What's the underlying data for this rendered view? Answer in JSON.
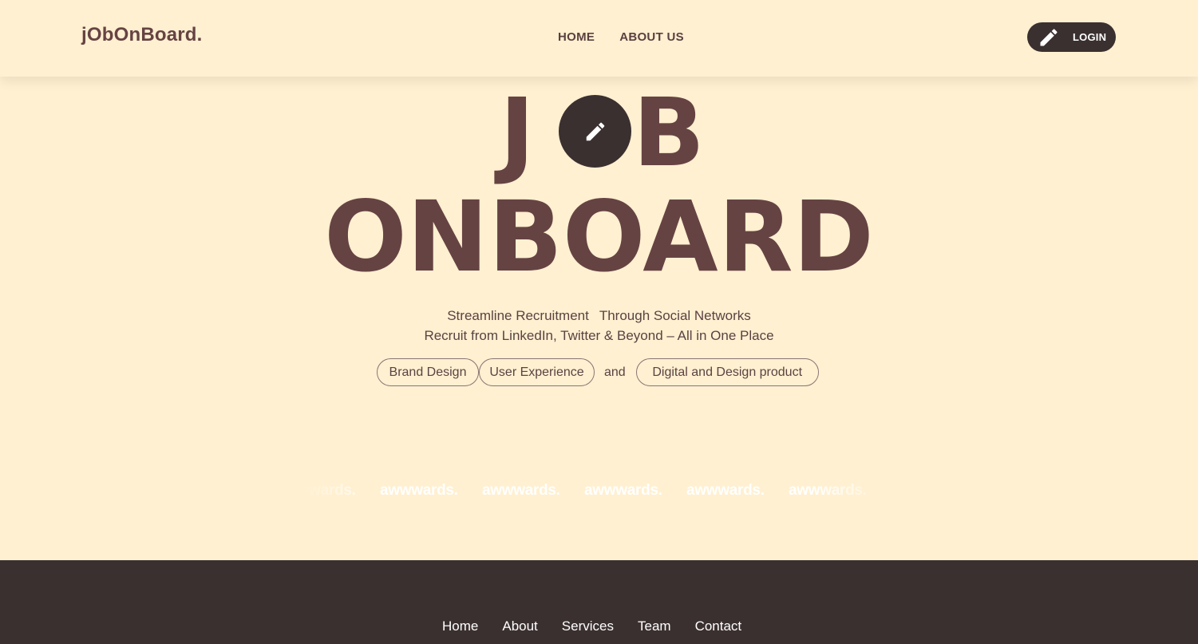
{
  "header": {
    "logo": "jObOnBoard.",
    "nav": [
      {
        "label": "HOME"
      },
      {
        "label": "ABOUT US"
      }
    ],
    "login_label": "LOGIN",
    "login_icon": "pencil-icon"
  },
  "hero": {
    "letter_j": "J",
    "letter_b": "B",
    "circle_icon": "pencil-icon",
    "line2": "ONBOARD",
    "subtitle_part1": "Streamline Recruitment",
    "subtitle_part2": "Through Social Networks",
    "subtitle2": "Recruit from LinkedIn, Twitter & Beyond – All in One Place",
    "chips": [
      "Brand Design",
      "User Experience",
      "Digital and Design product"
    ],
    "and_text": "and"
  },
  "awards": [
    "awwwards.",
    "awwwards.",
    "awwwards.",
    "awwwards.",
    "awwwards.",
    "awwwards."
  ],
  "footer": {
    "links": [
      "Home",
      "About",
      "Services",
      "Team",
      "Contact"
    ]
  },
  "colors": {
    "background": "#fff0d1",
    "primary_text": "#664343",
    "dark": "#3b3030"
  }
}
